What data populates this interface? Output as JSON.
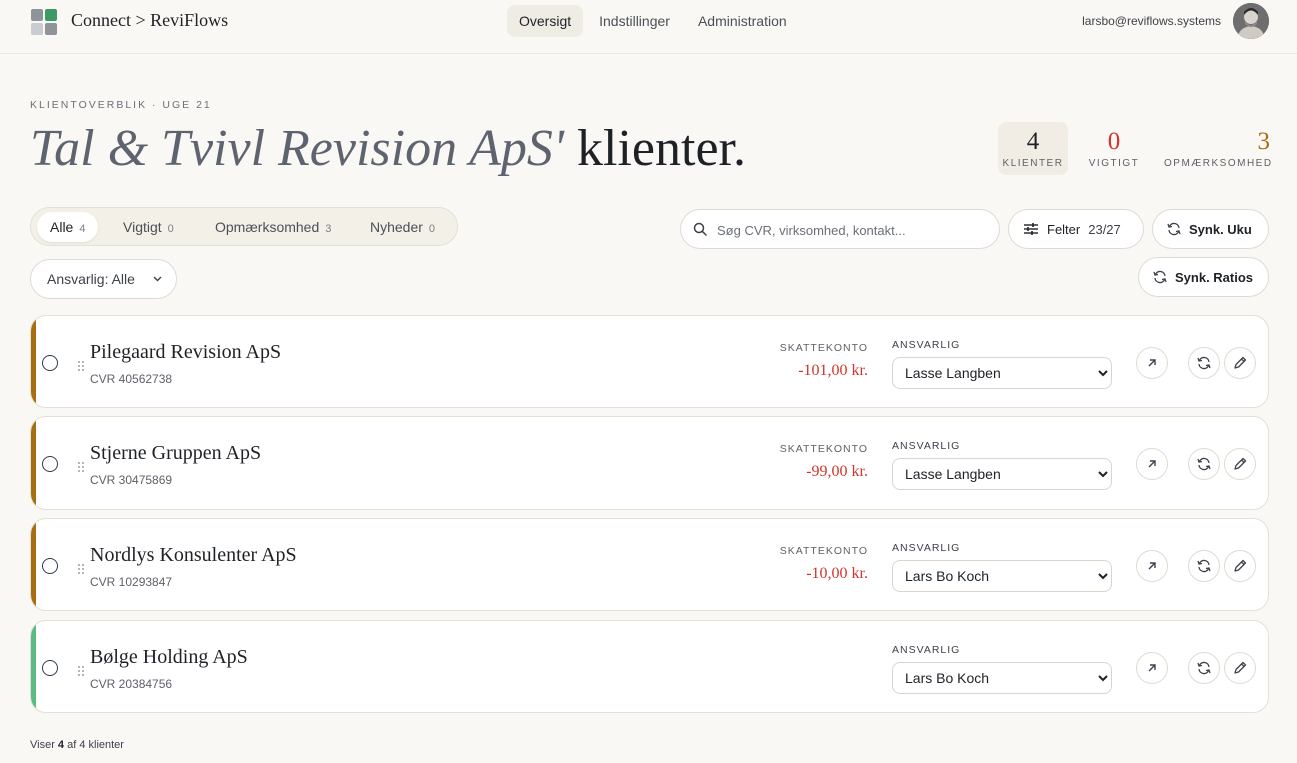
{
  "header": {
    "brand": "Connect > ReviFlows",
    "nav": [
      {
        "label": "Oversigt",
        "active": true
      },
      {
        "label": "Indstillinger",
        "active": false
      },
      {
        "label": "Administration",
        "active": false
      }
    ],
    "user_email": "larsbo@reviflows.systems"
  },
  "hero": {
    "eyebrow": "KLIENTOVERBLIK · UGE 21",
    "title_italic": "Tal & Tvivl Revision ApS'",
    "title_rest": " klienter."
  },
  "stats": [
    {
      "value": "4",
      "label": "KLIENTER",
      "color": "#1e2126"
    },
    {
      "value": "0",
      "label": "VIGTIGT",
      "color": "#d0342c"
    },
    {
      "value": "3",
      "label": "OPMÆRKSOMHED",
      "color": "#a86f12"
    }
  ],
  "filters": {
    "tabs": [
      {
        "label": "Alle",
        "count": "4",
        "active": true
      },
      {
        "label": "Vigtigt",
        "count": "0",
        "active": false
      },
      {
        "label": "Opmærksomhed",
        "count": "3",
        "active": false
      },
      {
        "label": "Nyheder",
        "count": "0",
        "active": false
      }
    ],
    "search_placeholder": "Søg CVR, virksomhed, kontakt...",
    "fields_label": "Felter",
    "fields_count": "23/27",
    "sync_uku_label": "Synk. Uku",
    "sync_ratios_label": "Synk. Ratios",
    "owner_filter_label": "Ansvarlig: Alle"
  },
  "table": {
    "tax_label": "SKATTEKONTO",
    "owner_label": "ANSVARLIG"
  },
  "clients": [
    {
      "name": "Pilegaard Revision ApS",
      "cvr": "CVR 40562738",
      "tax": "-101,00 kr.",
      "owner": "Lasse Langben",
      "accent": "#a86f12"
    },
    {
      "name": "Stjerne Gruppen ApS",
      "cvr": "CVR 30475869",
      "tax": "-99,00 kr.",
      "owner": "Lasse Langben",
      "accent": "#a86f12"
    },
    {
      "name": "Nordlys Konsulenter ApS",
      "cvr": "CVR 10293847",
      "tax": "-10,00 kr.",
      "owner": "Lars Bo Koch",
      "accent": "#a86f12"
    },
    {
      "name": "Bølge Holding ApS",
      "cvr": "CVR 20384756",
      "tax": "",
      "owner": "Lars Bo Koch",
      "accent": "#5bbb83"
    }
  ],
  "owners": [
    "Lasse Langben",
    "Lars Bo Koch"
  ],
  "footer": {
    "prefix": "Viser ",
    "shown": "4",
    "suffix": " af 4 klienter"
  }
}
